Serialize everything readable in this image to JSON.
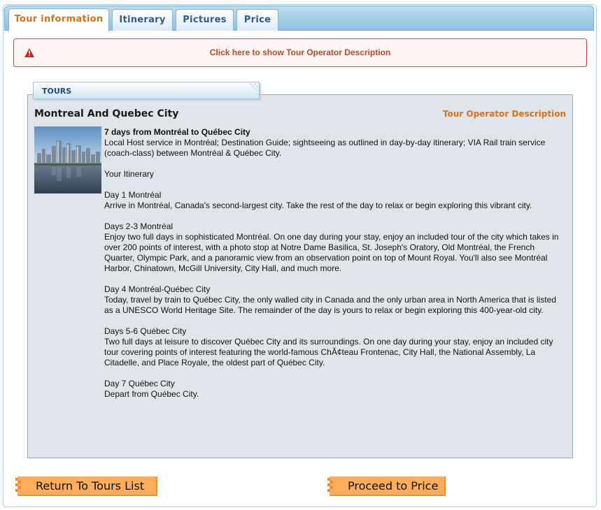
{
  "tabs": [
    {
      "label": "Tour information",
      "active": true
    },
    {
      "label": "Itinerary",
      "active": false
    },
    {
      "label": "Pictures",
      "active": false
    },
    {
      "label": "Price",
      "active": false
    }
  ],
  "alert": {
    "text": "Click here to show Tour Operator Description"
  },
  "section": {
    "label": "TOURS"
  },
  "tour": {
    "title": "Montreal And Quebec City",
    "operator_link": "Tour Operator Description",
    "lines": [
      {
        "text": "7 days from Montréal to Québec City",
        "bold": true
      },
      {
        "text": "Local Host service in Montréal; Destination Guide; sightseeing as outlined in day-by-day itinerary; VIA Rail train service"
      },
      {
        "text": "(coach-class) between Montréal & Québec City."
      },
      {
        "text": ""
      },
      {
        "text": "Your Itinerary"
      },
      {
        "text": ""
      },
      {
        "text": "Day 1 Montréal"
      },
      {
        "text": "Arrive in Montréal, Canada's second-largest city. Take the rest of the day to relax or begin exploring this vibrant city."
      },
      {
        "text": ""
      },
      {
        "text": "Days 2-3 Montréal"
      },
      {
        "text": "Enjoy two full days in sophisticated Montréal. On one day during your stay, enjoy an included tour of the city which takes in"
      },
      {
        "text": "over 200 points of interest, with a photo stop at Notre Dame Basilica, St. Joseph's Oratory, Old Montréal, the French"
      },
      {
        "text": "Quarter, Olympic Park, and a panoramic view from an observation point on top of Mount Royal. You'll also see Montréal"
      },
      {
        "text": "Harbor, Chinatown, McGill University, City Hall, and much more."
      },
      {
        "text": ""
      },
      {
        "text": "Day 4 Montréal-Québec City"
      },
      {
        "text": "Today, travel by train to Québec City, the only walled city in Canada and the only urban area in North America that is listed"
      },
      {
        "text": "as a UNESCO World Heritage Site. The remainder of the day is yours to relax or begin exploring this 400-year-old city."
      },
      {
        "text": ""
      },
      {
        "text": "Days 5-6 Québec City"
      },
      {
        "text": "Two full days at leisure to discover Québec City and its surroundings. On one day during your stay, enjoy an included city"
      },
      {
        "text": "tour covering points of interest featuring the world-famous ChĂ¢teau Frontenac, City Hall, the National Assembly, La"
      },
      {
        "text": "Citadelle, and Place Royale, the oldest part of Québec City."
      },
      {
        "text": ""
      },
      {
        "text": "Day 7 Québec City"
      },
      {
        "text": "Depart from Québec City."
      }
    ]
  },
  "buttons": {
    "return_label": "Return To Tours List",
    "proceed_label": "Proceed to Price"
  },
  "colors": {
    "accent": "#d5721f",
    "tab_text": "#2e5b88",
    "alert_border": "#d24444",
    "button": "#fdae5c",
    "panel_bg": "#e0e5ec"
  },
  "icons": {
    "alert": "warning-icon",
    "thumbnail": "montreal-skyline-image"
  }
}
